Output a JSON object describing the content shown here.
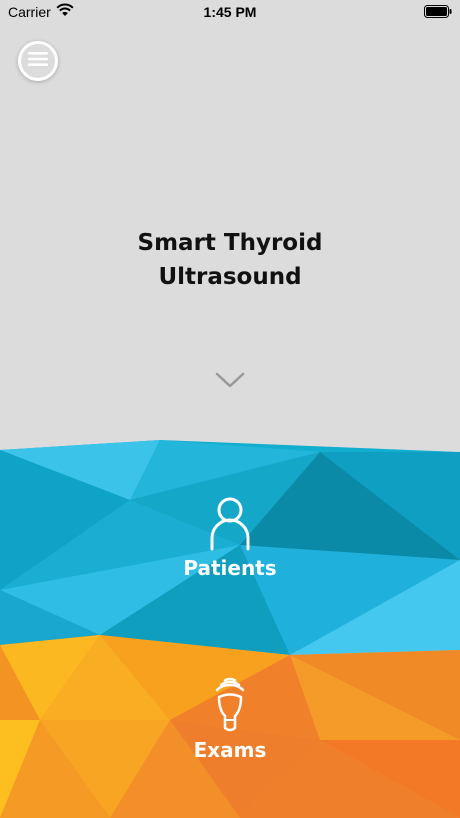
{
  "status_bar": {
    "carrier": "Carrier",
    "time": "1:45 PM",
    "wifi_icon": "wifi-icon",
    "battery_icon": "battery-icon"
  },
  "menu": {
    "icon": "hamburger-icon"
  },
  "app": {
    "title": "Smart Thyroid\nUltrasound"
  },
  "scroll_hint": {
    "icon": "chevron-down-icon"
  },
  "patients": {
    "label": "Patients",
    "icon": "person-icon",
    "color": "#1ab3d6"
  },
  "exams": {
    "label": "Exams",
    "icon": "ultrasound-probe-icon",
    "color": "#f5a024"
  }
}
